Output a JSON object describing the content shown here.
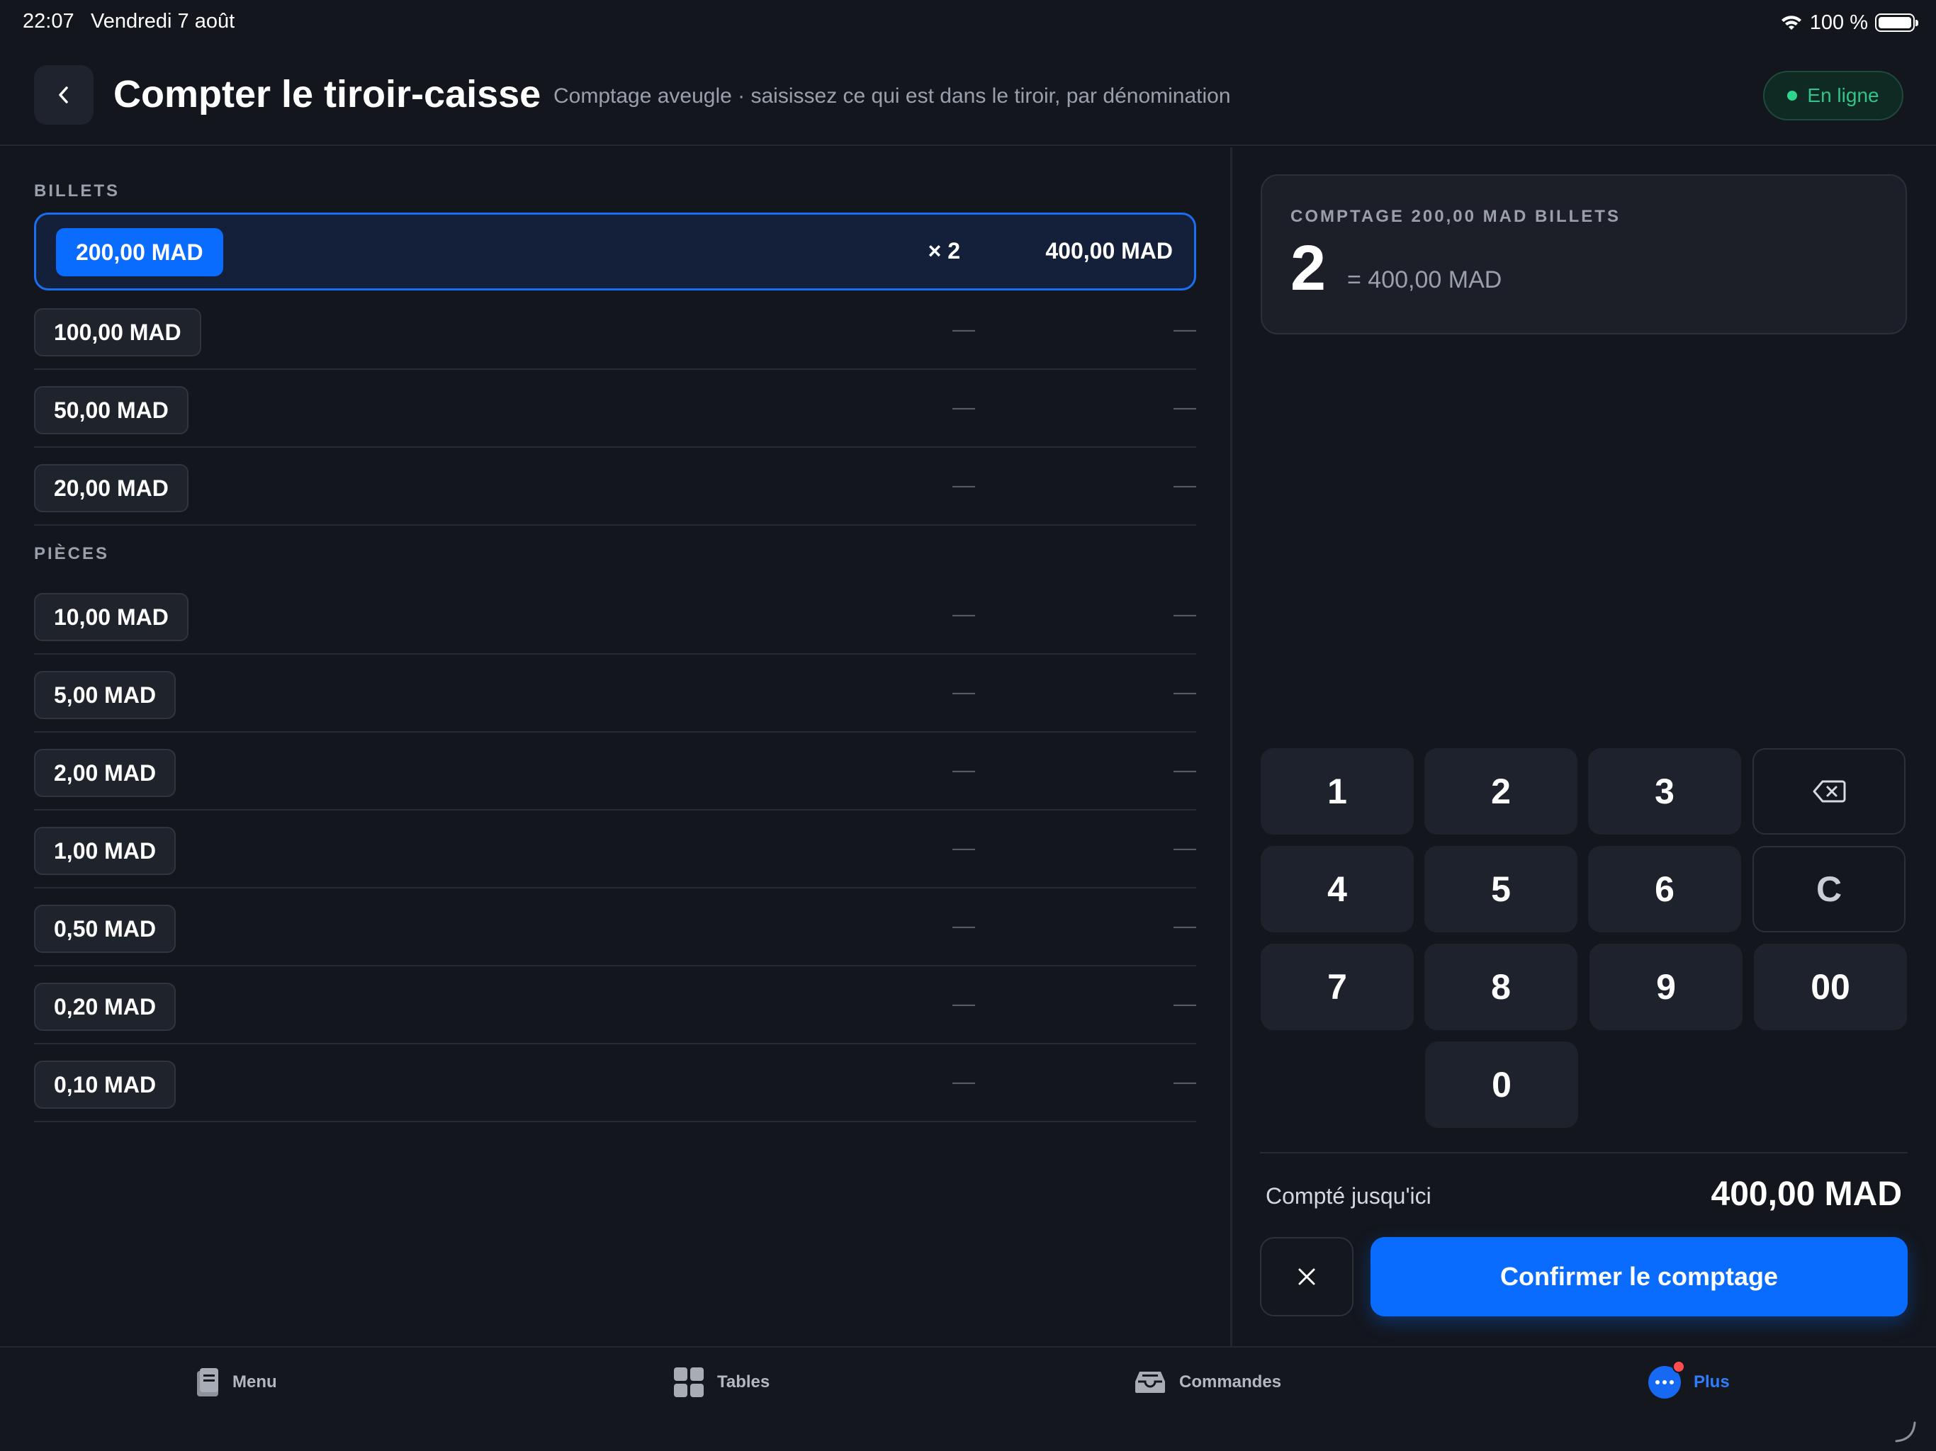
{
  "status_bar": {
    "time": "22:07",
    "date": "Vendredi 7 août",
    "battery": "100 %"
  },
  "header": {
    "title": "Compter le tiroir-caisse",
    "subtitle": "Comptage aveugle · saisissez ce qui est dans le tiroir, par dénomination",
    "status": "En ligne"
  },
  "sections": {
    "billets": "BILLETS",
    "pieces": "PIÈCES"
  },
  "bills": [
    {
      "label": "200,00 MAD",
      "qty": "× 2",
      "amount": "400,00 MAD"
    },
    {
      "label": "100,00 MAD",
      "qty": "—",
      "amount": "—"
    },
    {
      "label": "50,00 MAD",
      "qty": "—",
      "amount": "—"
    },
    {
      "label": "20,00 MAD",
      "qty": "—",
      "amount": "—"
    }
  ],
  "coins": [
    {
      "label": "10,00 MAD",
      "qty": "—",
      "amount": "—"
    },
    {
      "label": "5,00 MAD",
      "qty": "—",
      "amount": "—"
    },
    {
      "label": "2,00 MAD",
      "qty": "—",
      "amount": "—"
    },
    {
      "label": "1,00 MAD",
      "qty": "—",
      "amount": "—"
    },
    {
      "label": "0,50 MAD",
      "qty": "—",
      "amount": "—"
    },
    {
      "label": "0,20 MAD",
      "qty": "—",
      "amount": "—"
    },
    {
      "label": "0,10 MAD",
      "qty": "—",
      "amount": "—"
    }
  ],
  "count_card": {
    "caption": "COMPTAGE 200,00 MAD BILLETS",
    "value": "2",
    "equals": "= 400,00 MAD"
  },
  "keypad": {
    "k1": "1",
    "k2": "2",
    "k3": "3",
    "k4": "4",
    "k5": "5",
    "k6": "6",
    "k7": "7",
    "k8": "8",
    "k9": "9",
    "k00": "00",
    "k0": "0",
    "clear": "C"
  },
  "totals": {
    "label": "Compté jusqu'ici",
    "value": "400,00 MAD"
  },
  "confirm_label": "Confirmer le comptage",
  "tabs": {
    "menu": "Menu",
    "tables": "Tables",
    "orders": "Commandes",
    "more": "Plus"
  },
  "colors": {
    "accent": "#0a6cff",
    "online": "#32c38a",
    "background": "#13161d"
  }
}
